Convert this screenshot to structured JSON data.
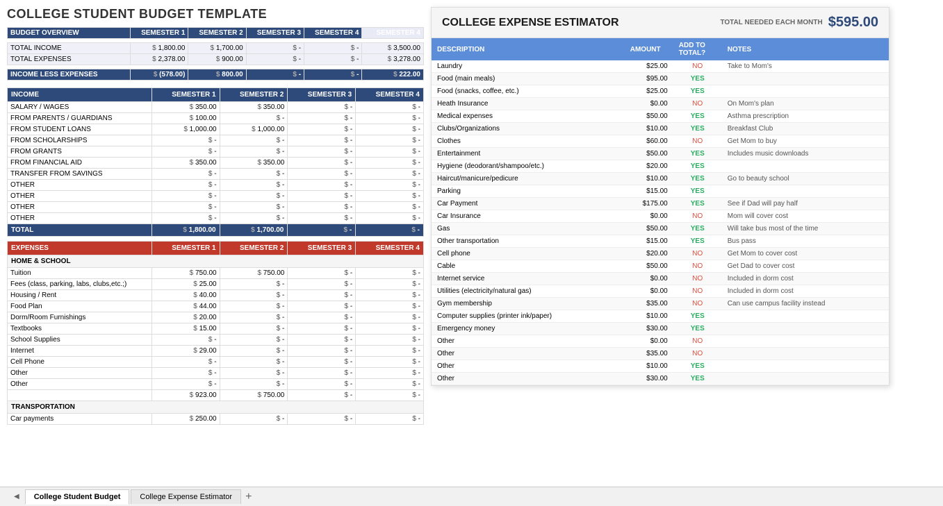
{
  "page": {
    "title": "COLLEGE STUDENT BUDGET TEMPLATE"
  },
  "tabs": [
    {
      "label": "College Student Budget",
      "active": true
    },
    {
      "label": "College Expense Estimator",
      "active": false
    }
  ],
  "overview": {
    "header": "BUDGET OVERVIEW",
    "columns": [
      "SEMESTER 1",
      "SEMESTER 2",
      "SEMESTER 3",
      "SEMESTER 4",
      "SEMESTER 4"
    ],
    "rows": [
      {
        "label": "TOTAL INCOME",
        "s1": "1,800.00",
        "s2": "1,700.00",
        "s3": "-",
        "s4": "-",
        "total": "3,500.00"
      },
      {
        "label": "TOTAL EXPENSES",
        "s1": "2,378.00",
        "s2": "900.00",
        "s3": "-",
        "s4": "-",
        "total": "3,278.00"
      }
    ],
    "income_less": {
      "label": "INCOME LESS EXPENSES",
      "s1": "(578.00)",
      "s2": "800.00",
      "s3": "-",
      "s4": "-",
      "total": "222.00"
    }
  },
  "income": {
    "header": "INCOME",
    "columns": [
      "SEMESTER 1",
      "SEMESTER 2",
      "SEMESTER 3",
      "SEMESTER 4"
    ],
    "rows": [
      {
        "label": "SALARY / WAGES",
        "s1": "350.00",
        "s2": "350.00",
        "s3": "-",
        "s4": "-"
      },
      {
        "label": "FROM PARENTS / GUARDIANS",
        "s1": "100.00",
        "s2": "-",
        "s3": "-",
        "s4": "-"
      },
      {
        "label": "FROM STUDENT LOANS",
        "s1": "1,000.00",
        "s2": "1,000.00",
        "s3": "-",
        "s4": "-"
      },
      {
        "label": "FROM SCHOLARSHIPS",
        "s1": "-",
        "s2": "-",
        "s3": "-",
        "s4": "-"
      },
      {
        "label": "FROM GRANTS",
        "s1": "-",
        "s2": "-",
        "s3": "-",
        "s4": "-"
      },
      {
        "label": "FROM FINANCIAL AID",
        "s1": "350.00",
        "s2": "350.00",
        "s3": "-",
        "s4": "-"
      },
      {
        "label": "TRANSFER FROM SAVINGS",
        "s1": "-",
        "s2": "-",
        "s3": "-",
        "s4": "-"
      },
      {
        "label": "OTHER",
        "s1": "-",
        "s2": "-",
        "s3": "-",
        "s4": "-"
      },
      {
        "label": "OTHER",
        "s1": "-",
        "s2": "-",
        "s3": "-",
        "s4": "-"
      },
      {
        "label": "OTHER",
        "s1": "-",
        "s2": "-",
        "s3": "-",
        "s4": "-"
      },
      {
        "label": "OTHER",
        "s1": "-",
        "s2": "-",
        "s3": "-",
        "s4": "-"
      }
    ],
    "total": {
      "label": "TOTAL",
      "s1": "1,800.00",
      "s2": "1,700.00",
      "s3": "-",
      "s4": "-"
    }
  },
  "expenses": {
    "header": "EXPENSES",
    "columns": [
      "SEMESTER 1",
      "SEMESTER 2",
      "SEMESTER 3",
      "SEMESTER 4"
    ],
    "categories": [
      {
        "label": "HOME & SCHOOL",
        "rows": [
          {
            "label": "Tuition",
            "s1": "750.00",
            "s2": "750.00",
            "s3": "-",
            "s4": "-"
          },
          {
            "label": "Fees (class, parking, labs, clubs,etc.;)",
            "s1": "25.00",
            "s2": "-",
            "s3": "-",
            "s4": "-"
          },
          {
            "label": "Housing / Rent",
            "s1": "40.00",
            "s2": "-",
            "s3": "-",
            "s4": "-"
          },
          {
            "label": "Food Plan",
            "s1": "44.00",
            "s2": "-",
            "s3": "-",
            "s4": "-"
          },
          {
            "label": "Dorm/Room Furnishings",
            "s1": "20.00",
            "s2": "-",
            "s3": "-",
            "s4": "-"
          },
          {
            "label": "Textbooks",
            "s1": "15.00",
            "s2": "-",
            "s3": "-",
            "s4": "-"
          },
          {
            "label": "School Supplies",
            "s1": "-",
            "s2": "-",
            "s3": "-",
            "s4": "-"
          },
          {
            "label": "Internet",
            "s1": "29.00",
            "s2": "-",
            "s3": "-",
            "s4": "-"
          },
          {
            "label": "Cell Phone",
            "s1": "-",
            "s2": "-",
            "s3": "-",
            "s4": "-"
          },
          {
            "label": "Other",
            "s1": "-",
            "s2": "-",
            "s3": "-",
            "s4": "-"
          },
          {
            "label": "Other",
            "s1": "-",
            "s2": "-",
            "s3": "-",
            "s4": "-"
          }
        ],
        "subtotal": {
          "s1": "923.00",
          "s2": "750.00",
          "s3": "-",
          "s4": "-"
        }
      }
    ],
    "transport_label": "TRANSPORTATION",
    "transport_rows": [
      {
        "label": "Car payments",
        "s1": "250.00",
        "s2": "-",
        "s3": "-",
        "s4": "-"
      }
    ]
  },
  "estimator": {
    "title": "COLLEGE EXPENSE ESTIMATOR",
    "total_label": "TOTAL NEEDED EACH MONTH",
    "total_value": "$595.00",
    "columns": [
      "DESCRIPTION",
      "AMOUNT",
      "ADD TO TOTAL?",
      "NOTES"
    ],
    "rows": [
      {
        "desc": "Laundry",
        "amount": "$25.00",
        "add": "NO",
        "notes": "Take to Mom's"
      },
      {
        "desc": "Food (main meals)",
        "amount": "$95.00",
        "add": "YES",
        "notes": ""
      },
      {
        "desc": "Food (snacks, coffee, etc.)",
        "amount": "$25.00",
        "add": "YES",
        "notes": ""
      },
      {
        "desc": "Heath Insurance",
        "amount": "$0.00",
        "add": "NO",
        "notes": "On Mom's plan"
      },
      {
        "desc": "Medical expenses",
        "amount": "$50.00",
        "add": "YES",
        "notes": "Asthma prescription"
      },
      {
        "desc": "Clubs/Organizations",
        "amount": "$10.00",
        "add": "YES",
        "notes": "Breakfast Club"
      },
      {
        "desc": "Clothes",
        "amount": "$60.00",
        "add": "NO",
        "notes": "Get Mom to buy"
      },
      {
        "desc": "Entertainment",
        "amount": "$50.00",
        "add": "YES",
        "notes": "Includes music downloads"
      },
      {
        "desc": "Hygiene (deodorant/shampoo/etc.)",
        "amount": "$20.00",
        "add": "YES",
        "notes": ""
      },
      {
        "desc": "Haircut/manicure/pedicure",
        "amount": "$10.00",
        "add": "YES",
        "notes": "Go to beauty school"
      },
      {
        "desc": "Parking",
        "amount": "$15.00",
        "add": "YES",
        "notes": ""
      },
      {
        "desc": "Car Payment",
        "amount": "$175.00",
        "add": "YES",
        "notes": "See if Dad will pay half"
      },
      {
        "desc": "Car Insurance",
        "amount": "$0.00",
        "add": "NO",
        "notes": "Mom will cover cost"
      },
      {
        "desc": "Gas",
        "amount": "$50.00",
        "add": "YES",
        "notes": "Will take bus most of the time"
      },
      {
        "desc": "Other transportation",
        "amount": "$15.00",
        "add": "YES",
        "notes": "Bus pass"
      },
      {
        "desc": "Cell phone",
        "amount": "$20.00",
        "add": "NO",
        "notes": "Get Mom to cover cost"
      },
      {
        "desc": "Cable",
        "amount": "$50.00",
        "add": "NO",
        "notes": "Get Dad to cover cost"
      },
      {
        "desc": "Internet service",
        "amount": "$0.00",
        "add": "NO",
        "notes": "Included in dorm cost"
      },
      {
        "desc": "Utilities (electricity/natural gas)",
        "amount": "$0.00",
        "add": "NO",
        "notes": "Included in dorm cost"
      },
      {
        "desc": "Gym membership",
        "amount": "$35.00",
        "add": "NO",
        "notes": "Can use campus facility instead"
      },
      {
        "desc": "Computer supplies (printer ink/paper)",
        "amount": "$10.00",
        "add": "YES",
        "notes": ""
      },
      {
        "desc": "Emergency money",
        "amount": "$30.00",
        "add": "YES",
        "notes": ""
      },
      {
        "desc": "Other",
        "amount": "$0.00",
        "add": "NO",
        "notes": ""
      },
      {
        "desc": "Other",
        "amount": "$35.00",
        "add": "NO",
        "notes": ""
      },
      {
        "desc": "Other",
        "amount": "$10.00",
        "add": "YES",
        "notes": ""
      },
      {
        "desc": "Other",
        "amount": "$30.00",
        "add": "YES",
        "notes": ""
      }
    ]
  }
}
